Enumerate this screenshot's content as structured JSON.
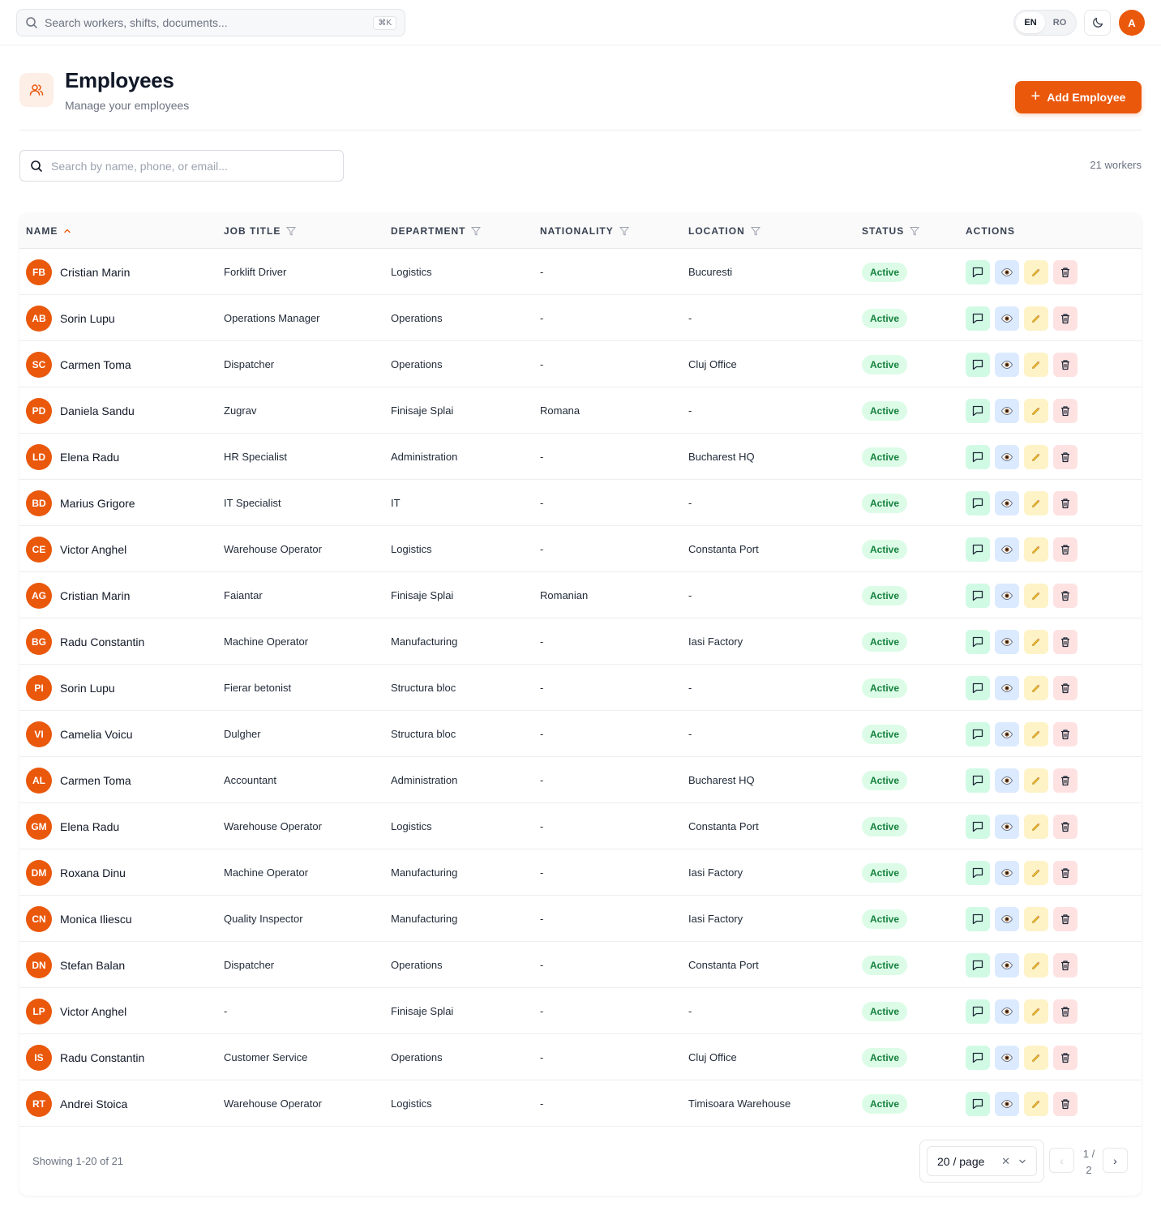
{
  "topbar": {
    "search_placeholder": "Search workers, shifts, documents...",
    "shortcut": "⌘K",
    "languages": [
      {
        "code": "EN",
        "active": true
      },
      {
        "code": "RO",
        "active": false
      }
    ],
    "theme_icon": "moon-icon",
    "user_initial": "A"
  },
  "header": {
    "icon": "users-icon",
    "title": "Employees",
    "subtitle": "Manage your employees",
    "add_button": "Add Employee"
  },
  "filters": {
    "search_placeholder": "Search by name, phone, or email...",
    "count_label": "21 workers"
  },
  "table": {
    "columns": [
      "NAME",
      "JOB TITLE",
      "DEPARTMENT",
      "NATIONALITY",
      "LOCATION",
      "STATUS",
      "ACTIONS"
    ],
    "sorted_column": "NAME",
    "filterable": [
      "JOB TITLE",
      "DEPARTMENT",
      "NATIONALITY",
      "LOCATION",
      "STATUS"
    ],
    "rows": [
      {
        "initials": "FB",
        "name": "Cristian Marin",
        "job": "Forklift Driver",
        "dept": "Logistics",
        "nat": "-",
        "loc": "Bucuresti",
        "status": "Active"
      },
      {
        "initials": "AB",
        "name": "Sorin Lupu",
        "job": "Operations Manager",
        "dept": "Operations",
        "nat": "-",
        "loc": "-",
        "status": "Active"
      },
      {
        "initials": "SC",
        "name": "Carmen Toma",
        "job": "Dispatcher",
        "dept": "Operations",
        "nat": "-",
        "loc": "Cluj Office",
        "status": "Active"
      },
      {
        "initials": "PD",
        "name": "Daniela Sandu",
        "job": "Zugrav",
        "dept": "Finisaje Splai",
        "nat": "Romana",
        "loc": "-",
        "status": "Active"
      },
      {
        "initials": "LD",
        "name": "Elena Radu",
        "job": "HR Specialist",
        "dept": "Administration",
        "nat": "-",
        "loc": "Bucharest HQ",
        "status": "Active"
      },
      {
        "initials": "BD",
        "name": "Marius Grigore",
        "job": "IT Specialist",
        "dept": "IT",
        "nat": "-",
        "loc": "-",
        "status": "Active"
      },
      {
        "initials": "CE",
        "name": "Victor Anghel",
        "job": "Warehouse Operator",
        "dept": "Logistics",
        "nat": "-",
        "loc": "Constanta Port",
        "status": "Active"
      },
      {
        "initials": "AG",
        "name": "Cristian Marin",
        "job": "Faiantar",
        "dept": "Finisaje Splai",
        "nat": "Romanian",
        "loc": "-",
        "status": "Active"
      },
      {
        "initials": "BG",
        "name": "Radu Constantin",
        "job": "Machine Operator",
        "dept": "Manufacturing",
        "nat": "-",
        "loc": "Iasi Factory",
        "status": "Active"
      },
      {
        "initials": "PI",
        "name": "Sorin Lupu",
        "job": "Fierar betonist",
        "dept": "Structura bloc",
        "nat": "-",
        "loc": "-",
        "status": "Active"
      },
      {
        "initials": "VI",
        "name": "Camelia Voicu",
        "job": "Dulgher",
        "dept": "Structura bloc",
        "nat": "-",
        "loc": "-",
        "status": "Active"
      },
      {
        "initials": "AL",
        "name": "Carmen Toma",
        "job": "Accountant",
        "dept": "Administration",
        "nat": "-",
        "loc": "Bucharest HQ",
        "status": "Active"
      },
      {
        "initials": "GM",
        "name": "Elena Radu",
        "job": "Warehouse Operator",
        "dept": "Logistics",
        "nat": "-",
        "loc": "Constanta Port",
        "status": "Active"
      },
      {
        "initials": "DM",
        "name": "Roxana Dinu",
        "job": "Machine Operator",
        "dept": "Manufacturing",
        "nat": "-",
        "loc": "Iasi Factory",
        "status": "Active"
      },
      {
        "initials": "CN",
        "name": "Monica Iliescu",
        "job": "Quality Inspector",
        "dept": "Manufacturing",
        "nat": "-",
        "loc": "Iasi Factory",
        "status": "Active"
      },
      {
        "initials": "DN",
        "name": "Stefan Balan",
        "job": "Dispatcher",
        "dept": "Operations",
        "nat": "-",
        "loc": "Constanta Port",
        "status": "Active"
      },
      {
        "initials": "LP",
        "name": "Victor Anghel",
        "job": "-",
        "dept": "Finisaje Splai",
        "nat": "-",
        "loc": "-",
        "status": "Active"
      },
      {
        "initials": "IS",
        "name": "Radu Constantin",
        "job": "Customer Service",
        "dept": "Operations",
        "nat": "-",
        "loc": "Cluj Office",
        "status": "Active"
      },
      {
        "initials": "RT",
        "name": "Andrei Stoica",
        "job": "Warehouse Operator",
        "dept": "Logistics",
        "nat": "-",
        "loc": "Timisoara Warehouse",
        "status": "Active"
      }
    ],
    "row_actions": [
      "message-icon",
      "eye-icon",
      "pencil-icon",
      "trash-icon"
    ]
  },
  "pagination": {
    "showing": "Showing 1-20 of 21",
    "page_size": "20 / page",
    "page_info_top": "1 /",
    "page_info_bottom": "2",
    "prev": "‹",
    "next": "›"
  },
  "colors": {
    "accent": "#ea580c",
    "badge_bg": "#dcfce7",
    "badge_text": "#15803d"
  }
}
